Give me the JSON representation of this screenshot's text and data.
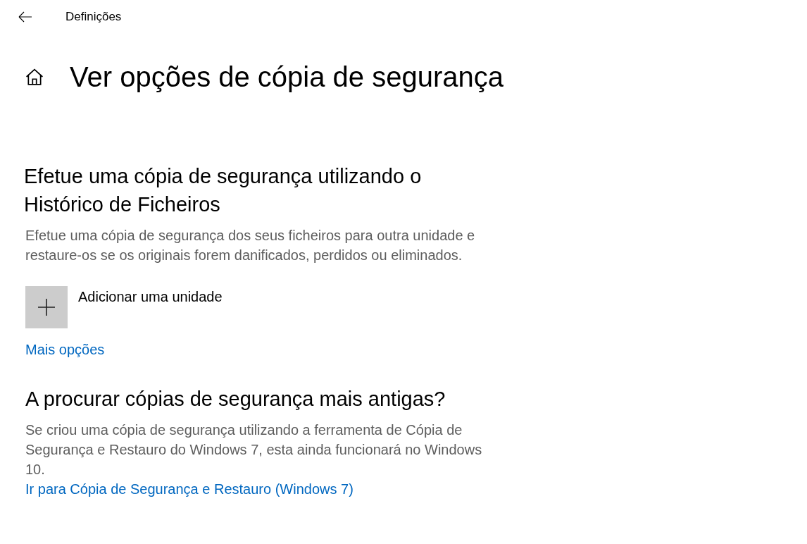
{
  "header": {
    "title": "Definições"
  },
  "page": {
    "title": "Ver opções de cópia de segurança"
  },
  "file_history": {
    "heading": "Efetue uma cópia de segurança utilizando o Histórico de Ficheiros",
    "description": "Efetue uma cópia de segurança dos seus ficheiros para outra unidade e restaure-os se os originais forem danificados, perdidos ou eliminados.",
    "add_drive": {
      "label": "Adicionar uma unidade"
    },
    "link": "Mais opções"
  },
  "older_backups": {
    "heading": "A procurar cópias de segurança mais antigas?",
    "description": "Se criou uma cópia de segurança utilizando a ferramenta de Cópia de Segurança e Restauro do Windows 7, esta ainda funcionará no Windows 10.",
    "link": "Ir para Cópia de Segurança e Restauro (Windows 7)"
  }
}
